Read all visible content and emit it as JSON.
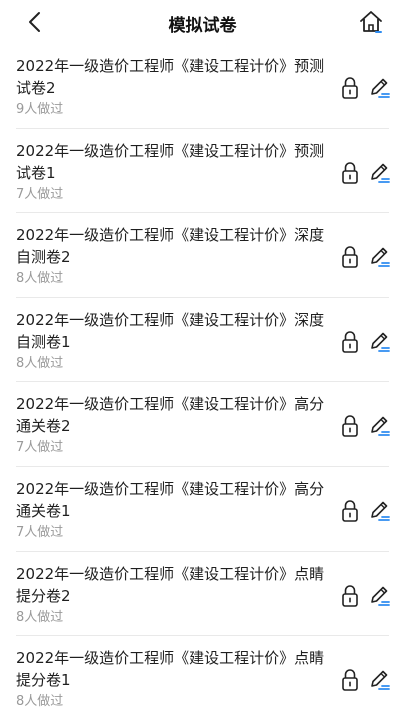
{
  "header": {
    "title": "模拟试卷",
    "back_icon": "chevron-left-icon",
    "home_icon": "home-icon",
    "home_accent": "#2f8cf0"
  },
  "papers": [
    {
      "title": "2022年一级造价工程师《建设工程计价》预测试卷2",
      "count": "9人做过"
    },
    {
      "title": "2022年一级造价工程师《建设工程计价》预测试卷1",
      "count": "7人做过"
    },
    {
      "title": "2022年一级造价工程师《建设工程计价》深度自测卷2",
      "count": "8人做过"
    },
    {
      "title": "2022年一级造价工程师《建设工程计价》深度自测卷1",
      "count": "8人做过"
    },
    {
      "title": "2022年一级造价工程师《建设工程计价》高分通关卷2",
      "count": "7人做过"
    },
    {
      "title": "2022年一级造价工程师《建设工程计价》高分通关卷1",
      "count": "7人做过"
    },
    {
      "title": "2022年一级造价工程师《建设工程计价》点睛提分卷2",
      "count": "8人做过"
    },
    {
      "title": "2022年一级造价工程师《建设工程计价》点睛提分卷1",
      "count": "8人做过"
    }
  ],
  "icons": {
    "lock": "lock-icon",
    "edit": "edit-icon",
    "edit_accent": "#2f8cf0"
  }
}
